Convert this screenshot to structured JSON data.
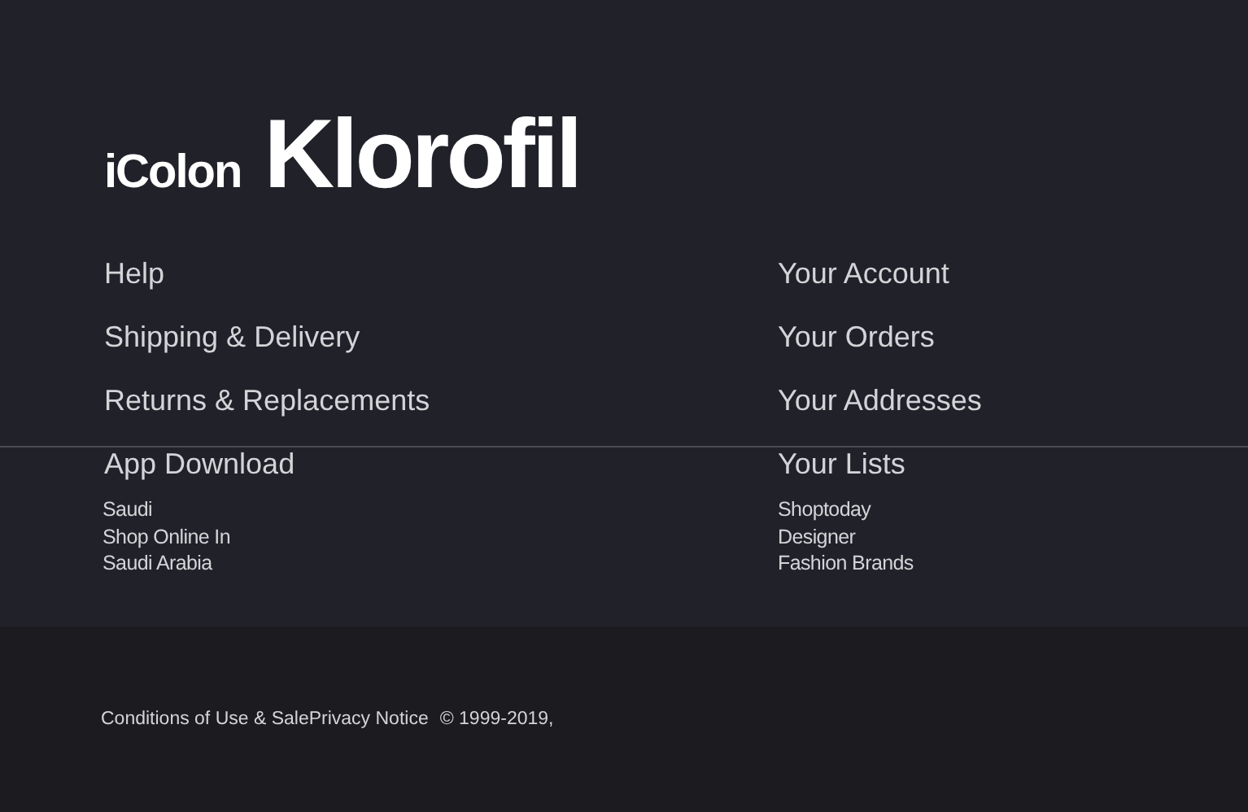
{
  "logo": {
    "prefix": "iColon",
    "name": "Klorofil"
  },
  "link_columns": [
    [
      "Help",
      "Shipping & Delivery",
      "Returns & Replacements",
      "App Download"
    ],
    [
      "Your Account",
      "Your Orders",
      "Your Addresses",
      "Your Lists"
    ]
  ],
  "promo_columns": [
    [
      "Saudi",
      "Shop Online In",
      "Saudi Arabia"
    ],
    [
      "Shoptoday",
      "Designer",
      "Fashion Brands"
    ]
  ],
  "bottom_bar": {
    "links": [
      "Conditions of Use & Sale",
      "Privacy Notice"
    ],
    "copyright": "© 1999-2019,"
  }
}
